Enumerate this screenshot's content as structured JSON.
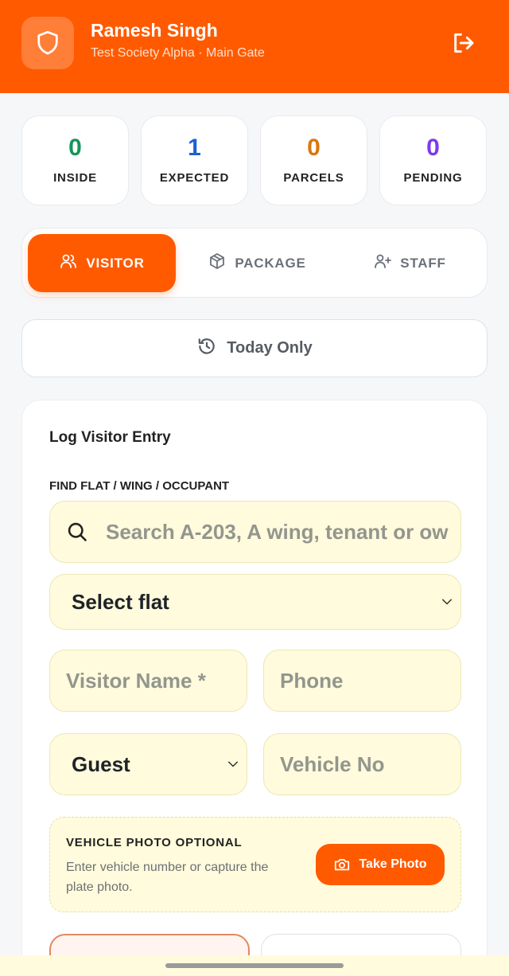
{
  "header": {
    "user_name": "Ramesh Singh",
    "subtitle": "Test Society Alpha · Main Gate",
    "shield_icon": "shield-icon",
    "logout_icon": "logout-icon",
    "color": "#ff5a00"
  },
  "stats": [
    {
      "value": "0",
      "label": "INSIDE",
      "color": "#15965a"
    },
    {
      "value": "1",
      "label": "EXPECTED",
      "color": "#1d5fd6"
    },
    {
      "value": "0",
      "label": "PARCELS",
      "color": "#d9770f"
    },
    {
      "value": "0",
      "label": "PENDING",
      "color": "#7c3aed"
    }
  ],
  "tabs": [
    {
      "label": "VISITOR",
      "icon": "users-icon",
      "active": true
    },
    {
      "label": "PACKAGE",
      "icon": "package-icon",
      "active": false
    },
    {
      "label": "STAFF",
      "icon": "user-plus-icon",
      "active": false
    }
  ],
  "filter": {
    "label": "Today Only",
    "icon": "history-icon"
  },
  "form": {
    "title": "Log Visitor Entry",
    "find_label": "FIND FLAT / WING / OCCUPANT",
    "search_placeholder": "Search A-203, A wing, tenant or ow",
    "flat_select": "Select flat",
    "visitor_name_placeholder": "Visitor Name *",
    "phone_placeholder": "Phone",
    "visitor_type": "Guest",
    "vehicle_placeholder": "Vehicle No",
    "vehicle_photo": {
      "title": "VEHICLE PHOTO OPTIONAL",
      "description": "Enter vehicle number or capture the plate photo.",
      "button": "Take Photo"
    }
  }
}
